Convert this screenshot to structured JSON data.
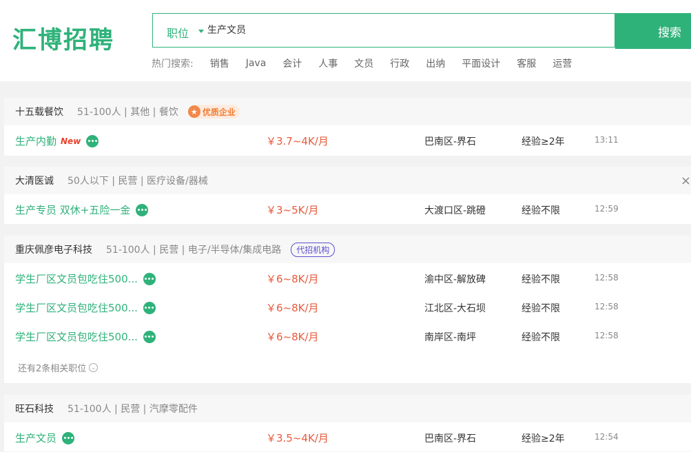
{
  "header": {
    "logo": "汇博招聘",
    "search_type": "职位",
    "search_value": "生产文员",
    "search_button": "搜索",
    "hot_label": "热门搜索:",
    "hot_items": [
      "销售",
      "Java",
      "会计",
      "人事",
      "文员",
      "行政",
      "出纳",
      "平面设计",
      "客服",
      "运营"
    ]
  },
  "companies": [
    {
      "name": "十五载餐饮",
      "info": "51-100人 | 其他 | 餐饮",
      "badge": "优质企业",
      "jobs": [
        {
          "title": "生产内勤",
          "tag": "New",
          "salary": "￥3.7~4K/月",
          "location": "巴南区-界石",
          "experience": "经验≥2年",
          "time": "13:11"
        }
      ]
    },
    {
      "name": "大清医诚",
      "info": "50人以下 | 民营 | 医疗设备/器械",
      "close": "×",
      "jobs": [
        {
          "title": "生产专员 双休+五险一金",
          "salary": "￥3~5K/月",
          "location": "大渡口区-跳磴",
          "experience": "经验不限",
          "time": "12:59"
        }
      ]
    },
    {
      "name": "重庆佩彦电子科技",
      "info": "51-100人 | 民营 | 电子/半导体/集成电路",
      "badge": "代招机构",
      "jobs": [
        {
          "title": "学生厂区文员包吃住500...",
          "salary": "￥6~8K/月",
          "location": "渝中区-解放碑",
          "experience": "经验不限",
          "time": "12:58"
        },
        {
          "title": "学生厂区文员包吃住500...",
          "salary": "￥6~8K/月",
          "location": "江北区-大石坝",
          "experience": "经验不限",
          "time": "12:58"
        },
        {
          "title": "学生厂区文员包吃住500...",
          "salary": "￥6~8K/月",
          "location": "南岸区-南坪",
          "experience": "经验不限",
          "time": "12:58"
        }
      ],
      "more": "还有2条相关职位"
    },
    {
      "name": "旺石科技",
      "info": "51-100人 | 民营 | 汽摩零配件",
      "jobs": [
        {
          "title": "生产文员",
          "salary": "￥3.5~4K/月",
          "location": "巴南区-界石",
          "experience": "经验≥2年",
          "time": "12:54"
        }
      ]
    }
  ],
  "icons": {
    "badge_star": "star-icon",
    "chat": "chat-icon",
    "expand": "chevron-down-icon",
    "close": "close-icon"
  },
  "colors": {
    "brand": "#2fb27a",
    "salary": "#e8593c",
    "new_tag": "#e8402b",
    "quality_badge": "#f07d33",
    "agency_badge": "#5b4fcf"
  }
}
